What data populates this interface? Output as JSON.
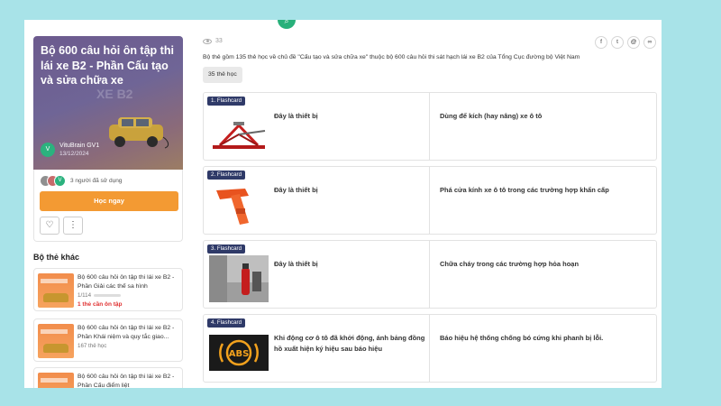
{
  "deck": {
    "title": "Bộ 600 câu hỏi ôn tập thi lái xe B2 - Phần Cấu tạo và sửa chữa xe",
    "cover_watermark": "XE B2",
    "author_initial": "V",
    "author": "VituBrain GV1",
    "date": "13/12/2024",
    "users_initial": "V",
    "users_text": "3 người đã sử dụng",
    "study_button": "Học ngay",
    "views": "33",
    "description": "Bộ thẻ gồm 135 thẻ học về chủ đề \"Cấu tạo và sửa chữa xe\" thuộc bộ 600 câu hỏi thi sát hạch lái xe B2 của Tổng Cục đường bộ Việt Nam",
    "card_count": "35 thẻ học"
  },
  "share": {
    "facebook": "f",
    "twitter": "t",
    "email": "@",
    "link": "∞"
  },
  "icons": {
    "heart": "heart-icon",
    "more": "more-vertical-icon",
    "eye": "eye-icon",
    "search": "search-icon"
  },
  "other_section": {
    "title": "Bộ thẻ khác",
    "items": [
      {
        "title": "Bộ 600 câu hỏi ôn tập thi lái xe B2 - Phần Giải các thế sa hình",
        "meta": "1/114",
        "progress": 0.01,
        "due": "1 thẻ cần ôn tập"
      },
      {
        "title": "Bộ 600 câu hỏi ôn tập thi lái xe B2 - Phần Khái niệm và quy tắc giao...",
        "meta": "167 thẻ học"
      },
      {
        "title": "Bộ 600 câu hỏi ôn tập thi lái xe B2 - Phần Cấu điểm liệt"
      }
    ]
  },
  "cards": [
    {
      "badge": "1. Flashcard",
      "term": "Đây là thiết bị",
      "definition": "Dùng để kích (hay nâng) xe ô tô",
      "image": "car-jack"
    },
    {
      "badge": "2. Flashcard",
      "term": "Đây là thiết bị",
      "definition": "Phá cửa kính xe ô tô trong các trường hợp khẩn cấp",
      "image": "emergency-hammer"
    },
    {
      "badge": "3. Flashcard",
      "term": "Đây là thiết bị",
      "definition": "Chữa cháy trong các trường hợp hỏa hoạn",
      "image": "fire-extinguisher"
    },
    {
      "badge": "4. Flashcard",
      "term": "Khi động cơ ô tô đã khởi động, ánh bảng đồng hồ xuất hiện ký hiệu sau báo hiệu",
      "definition": "Báo hiệu hệ thống chống bó cứng khi phanh bị lỗi.",
      "image": "abs-warning-light",
      "image_text": "ABS"
    }
  ],
  "colors": {
    "background": "#a8e3e8",
    "accent": "#f39a33",
    "badge": "#2f3a68",
    "brand_green": "#2bb27e",
    "due_red": "#e03131"
  }
}
